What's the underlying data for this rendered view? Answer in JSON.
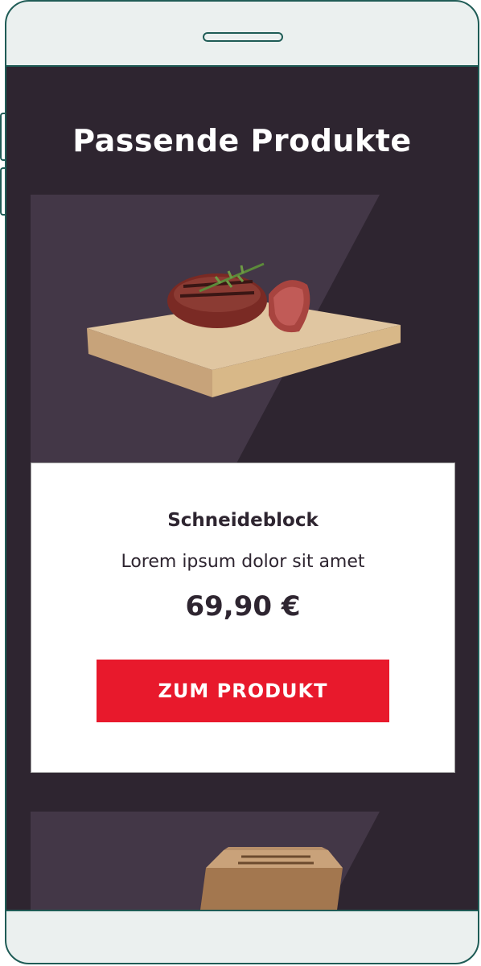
{
  "section": {
    "title": "Passende Produkte"
  },
  "products": [
    {
      "name": "Schneideblock",
      "description": "Lorem ipsum dolor sit amet",
      "price": "69,90 €",
      "cta_label": "ZUM PRODUKT",
      "image": "cutting-board-with-steak"
    },
    {
      "image": "knife-block"
    }
  ],
  "colors": {
    "background": "#2e2530",
    "panel": "#433747",
    "cta": "#e8192c",
    "frame": "#1f5c56"
  }
}
